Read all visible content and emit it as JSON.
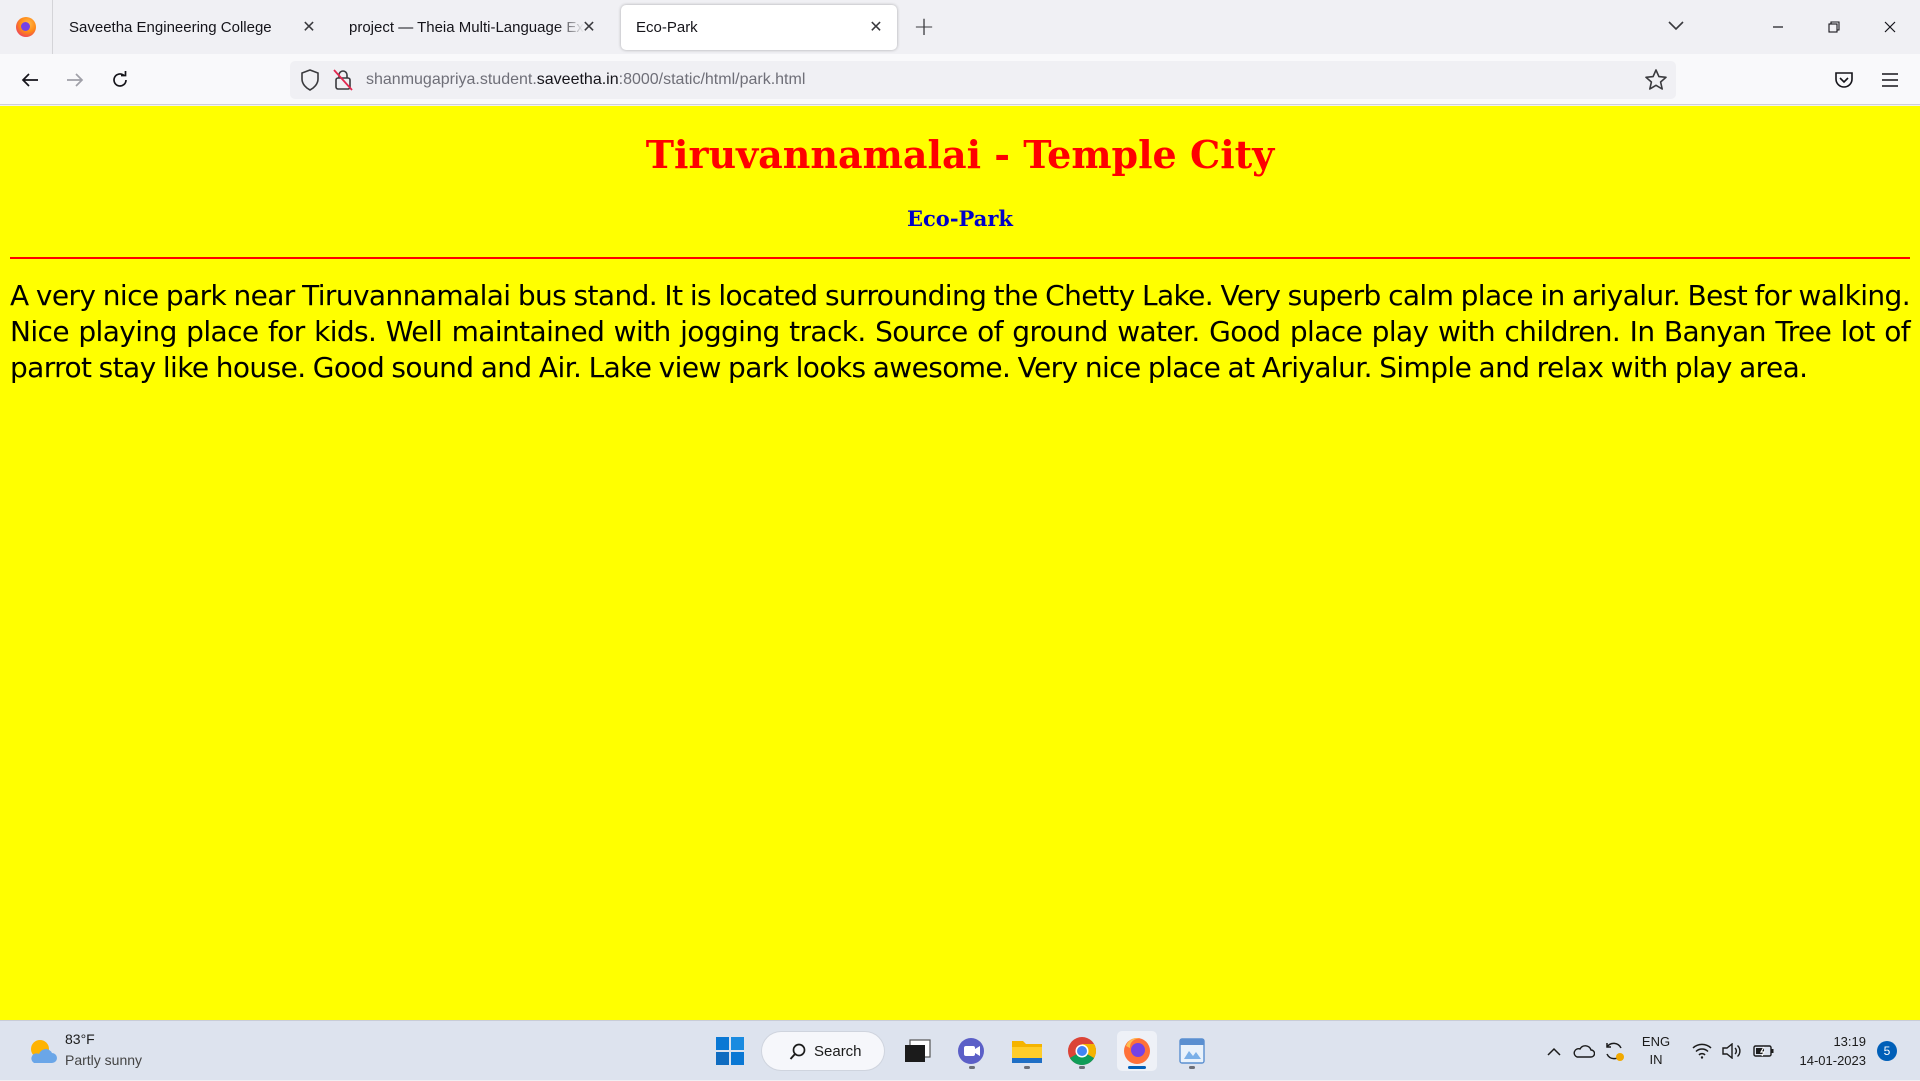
{
  "browser": {
    "tabs": [
      {
        "label": "Saveetha Engineering College",
        "active": false
      },
      {
        "label": "project — Theia Multi-Language Example",
        "active": false
      },
      {
        "label": "Eco-Park",
        "active": true
      }
    ],
    "url": {
      "prefix": "shanmugapriya.student.",
      "host": "saveetha.in",
      "suffix": ":8000/static/html/park.html"
    },
    "close_glyph": "✕",
    "new_tab_glyph": "+"
  },
  "page": {
    "title": "Tiruvannamalai - Temple City",
    "subtitle": "Eco-Park",
    "body": "A very nice park near Tiruvannamalai bus stand. It is located surrounding the Chetty Lake. Very superb calm place in ariyalur. Best for walking. Nice playing place for kids. Well maintained with jogging track. Source of ground water. Good place play with children. In Banyan Tree lot of parrot stay like house. Good sound and Air. Lake view park looks awesome. Very nice place at Ariyalur. Simple and relax with play area.",
    "colors": {
      "background": "#ffff00",
      "title": "#ff0000",
      "subtitle": "#0000c8",
      "rule": "#ff0000"
    }
  },
  "taskbar": {
    "weather": {
      "temp": "83°F",
      "desc": "Partly sunny",
      "icon": "partly-sunny-icon"
    },
    "search_label": "Search",
    "apps": [
      "windows-start-icon",
      "task-view-icon",
      "meet-icon",
      "file-explorer-icon",
      "chrome-icon",
      "firefox-icon",
      "paint-icon"
    ],
    "lang_top": "ENG",
    "lang_bottom": "IN",
    "time": "13:19",
    "date": "14-01-2023",
    "notification_count": "5"
  }
}
